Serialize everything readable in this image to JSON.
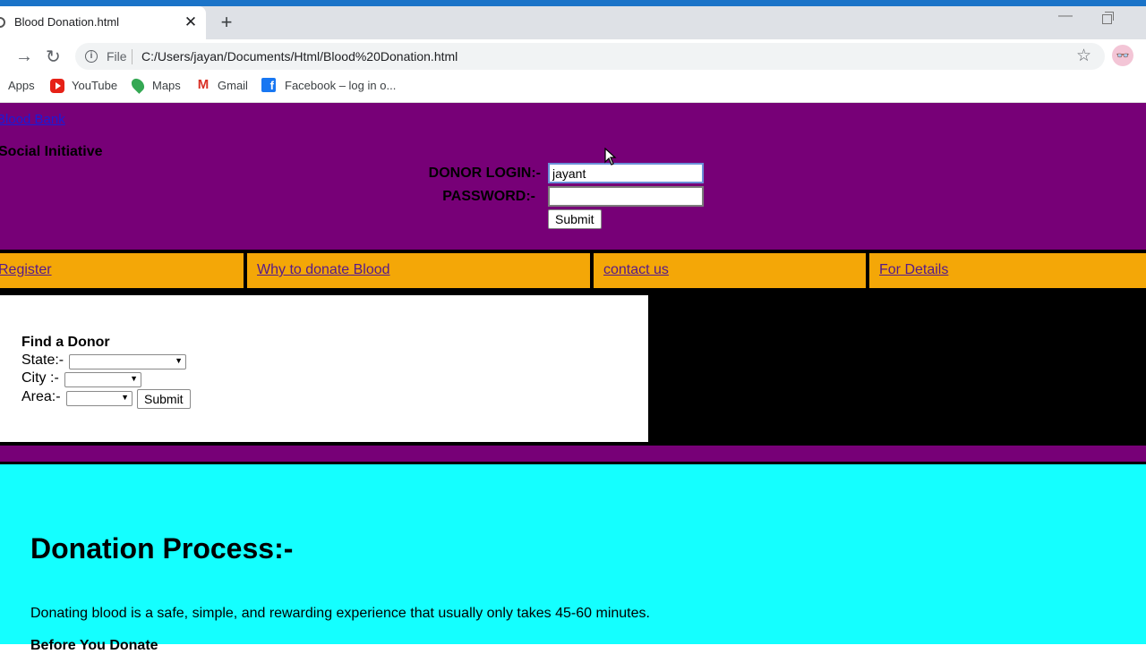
{
  "browser": {
    "tab_title": "Blood Donation.html",
    "tab_close": "✕",
    "new_tab": "+",
    "url_scheme": "File",
    "url": "C:/Users/jayan/Documents/Html/Blood%20Donation.html",
    "bookmarks": [
      {
        "label": "Apps",
        "icon": "apps-grid-icon"
      },
      {
        "label": "YouTube",
        "icon": "youtube-icon"
      },
      {
        "label": "Maps",
        "icon": "maps-icon"
      },
      {
        "label": "Gmail",
        "icon": "gmail-icon"
      },
      {
        "label": "Facebook – log in o...",
        "icon": "facebook-icon"
      }
    ],
    "accent_color": "#1a73c8"
  },
  "header": {
    "logo_text": "Blood Bank",
    "subtitle": "Social Initiative",
    "login_label": "DONOR LOGIN:-",
    "login_value": "jayant",
    "password_label": "PASSWORD:-",
    "password_value": "",
    "submit_label": "Submit",
    "background": "#770077"
  },
  "nav": {
    "items": [
      "Register",
      "Why to donate Blood",
      "contact us",
      "For Details"
    ],
    "background": "#f4a707"
  },
  "find_donor": {
    "title": "Find a Donor",
    "state_label": "State:-",
    "city_label": "City :-",
    "area_label": "Area:-",
    "submit_label": "Submit"
  },
  "content": {
    "heading": "Donation Process:-",
    "intro": "Donating blood is a safe, simple, and rewarding experience that usually only takes 45-60 minutes.",
    "subheading": "Before You Donate",
    "background": "#14ffff"
  }
}
